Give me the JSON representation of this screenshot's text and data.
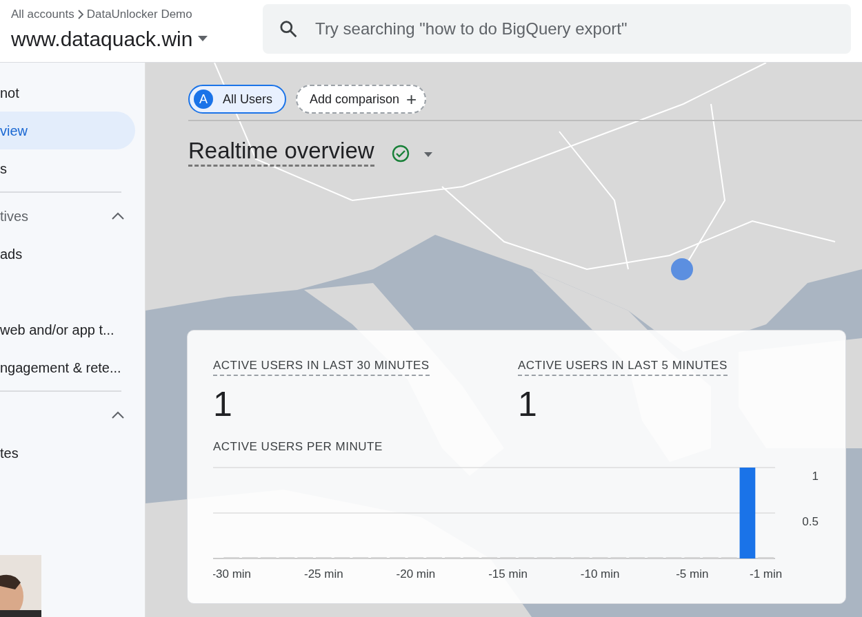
{
  "header": {
    "breadcrumb": [
      "All accounts",
      "DataUnlocker Demo"
    ],
    "property": "www.dataquack.win",
    "search": {
      "placeholder": "Try searching \"how to do BigQuery export\""
    }
  },
  "sidebar": {
    "items": [
      {
        "kind": "item",
        "label": "not",
        "selected": false
      },
      {
        "kind": "item",
        "label": "view",
        "selected": true
      },
      {
        "kind": "item",
        "label": "s",
        "selected": false
      },
      {
        "kind": "divider"
      },
      {
        "kind": "header",
        "label": "tives",
        "expanded": true
      },
      {
        "kind": "item",
        "label": "ads",
        "selected": false
      },
      {
        "kind": "spacer"
      },
      {
        "kind": "item",
        "label": "web and/or app t...",
        "selected": false
      },
      {
        "kind": "item",
        "label": "ngagement & rete...",
        "selected": false
      },
      {
        "kind": "divider"
      },
      {
        "kind": "header",
        "expanded": true
      },
      {
        "kind": "item",
        "label": "tes",
        "selected": false
      }
    ]
  },
  "comparisons": [
    {
      "kind": "segment",
      "avatar": "A",
      "label": "All Users"
    },
    {
      "kind": "add",
      "label": "Add comparison",
      "symbol": "+"
    }
  ],
  "title": "Realtime overview",
  "card": {
    "metrics": [
      {
        "label": "ACTIVE USERS IN LAST 30 MINUTES",
        "value": "1"
      },
      {
        "label": "ACTIVE USERS IN LAST 5 MINUTES",
        "value": "1"
      }
    ],
    "chart_title": "ACTIVE USERS PER MINUTE",
    "chart_data": {
      "type": "bar",
      "x": [
        -30,
        -29,
        -28,
        -27,
        -26,
        -25,
        -24,
        -23,
        -22,
        -21,
        -20,
        -19,
        -18,
        -17,
        -16,
        -15,
        -14,
        -13,
        -12,
        -11,
        -10,
        -9,
        -8,
        -7,
        -6,
        -5,
        -4,
        -3,
        -2,
        -1
      ],
      "values": [
        0,
        0,
        0,
        0,
        0,
        0,
        0,
        0,
        0,
        0,
        0,
        0,
        0,
        0,
        0,
        0,
        0,
        0,
        0,
        0,
        0,
        0,
        0,
        0,
        0,
        0,
        0,
        0,
        1,
        0
      ],
      "xlim": [
        -31,
        -0.5
      ],
      "ylim": [
        0,
        1
      ],
      "yticks": [
        {
          "value": 0.5,
          "label": "0.5"
        },
        {
          "value": 1,
          "label": "1"
        }
      ],
      "xticks": [
        {
          "value": -30,
          "label": "-30 min"
        },
        {
          "value": -25,
          "label": "-25 min"
        },
        {
          "value": -20,
          "label": "-20 min"
        },
        {
          "value": -15,
          "label": "-15 min"
        },
        {
          "value": -10,
          "label": "-10 min"
        },
        {
          "value": -5,
          "label": "-5 min"
        },
        {
          "value": -1,
          "label": "-1 min"
        }
      ]
    }
  }
}
